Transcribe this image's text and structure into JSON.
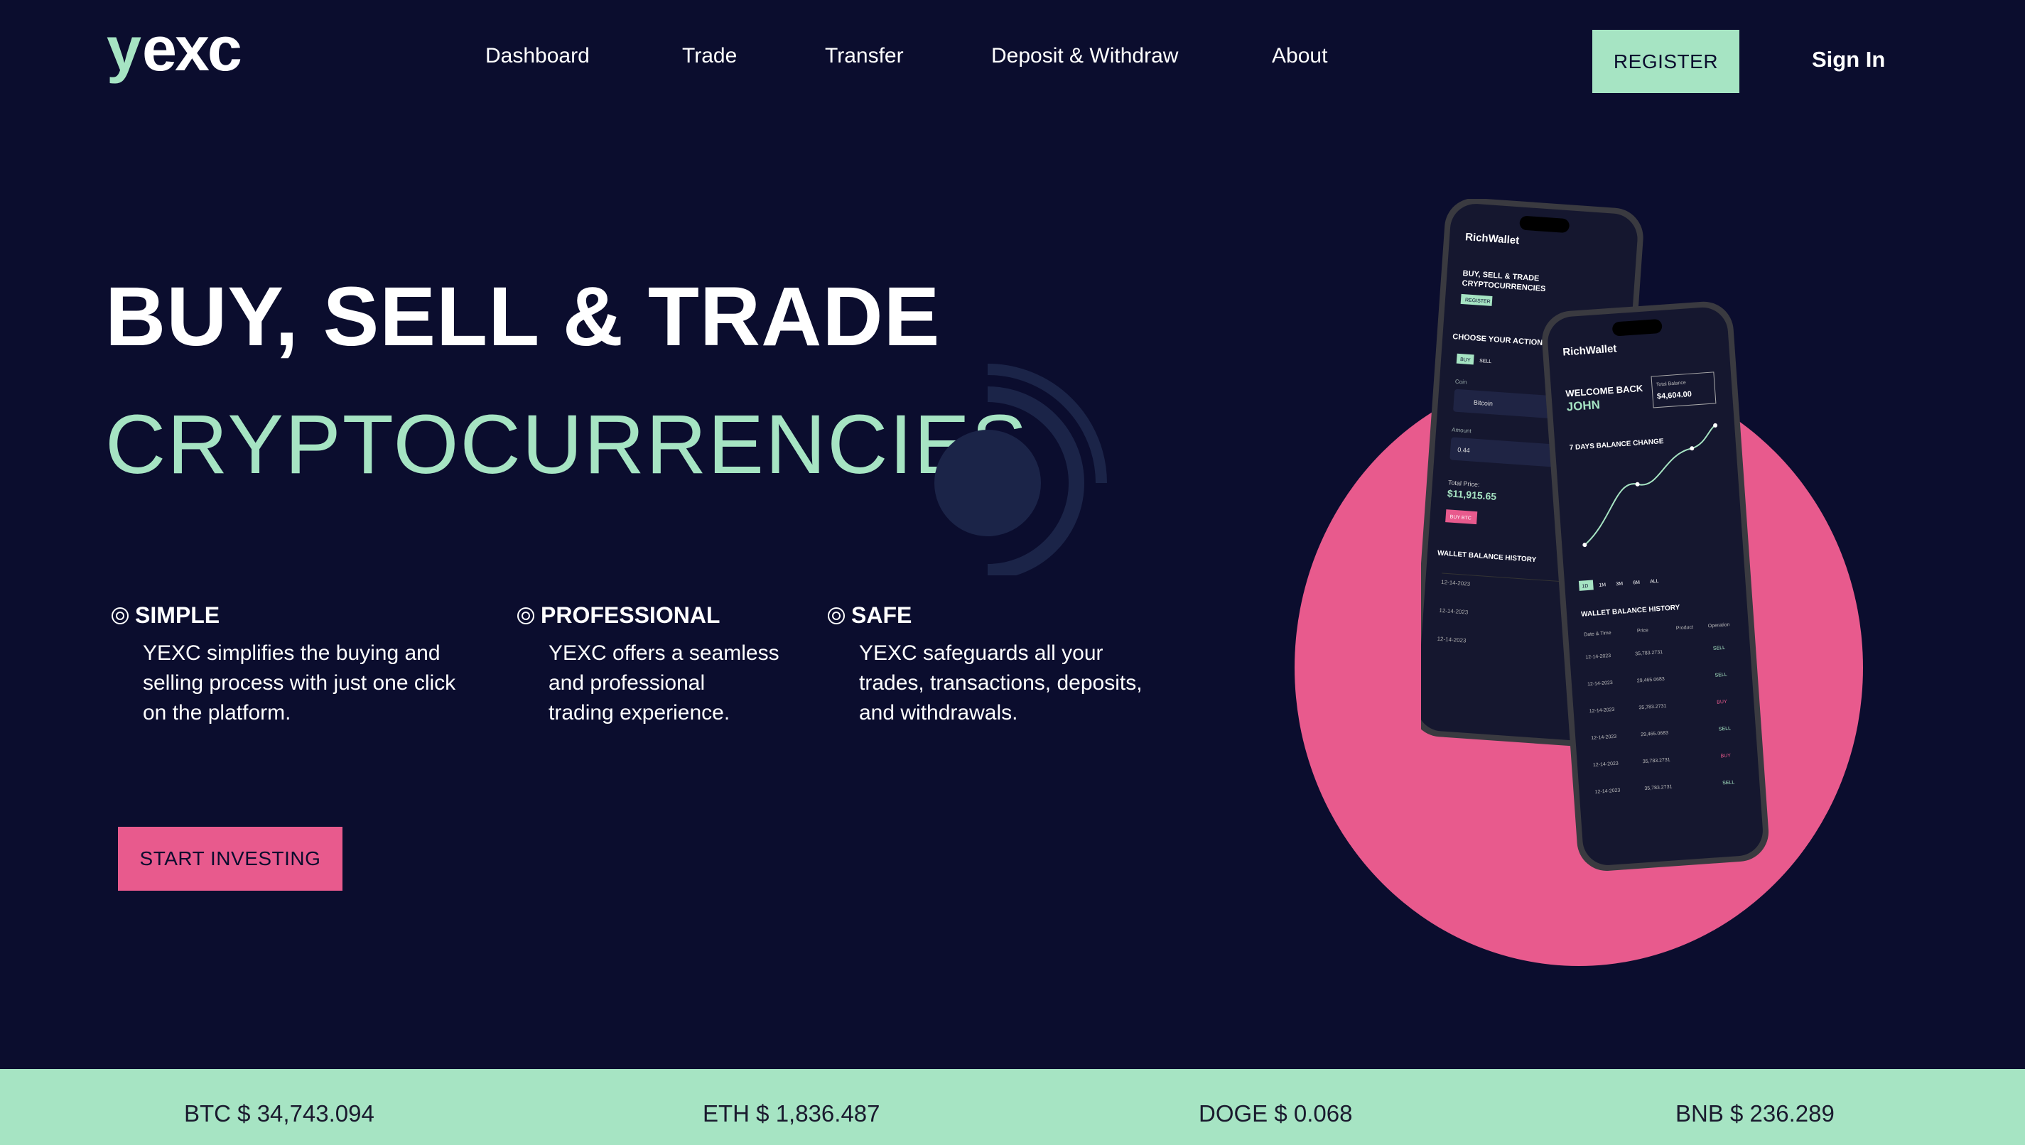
{
  "brand": {
    "logo_text": "yexc",
    "accent": "#a6e4c3",
    "pink": "#e85a8d",
    "background": "#0b0d2e"
  },
  "nav": {
    "items": [
      "Dashboard",
      "Trade",
      "Transfer",
      "Deposit & Withdraw",
      "About"
    ],
    "register_label": "REGISTER",
    "signin_label": "Sign In"
  },
  "hero": {
    "line1": "BUY, SELL & TRADE",
    "line2": "CRYPTOCURRENCIES",
    "features": [
      {
        "icon": "target-icon",
        "title": "SIMPLE",
        "lines": [
          "YEXC simplifies the buying and",
          "selling process with just one click",
          "on the platform."
        ]
      },
      {
        "icon": "target-icon",
        "title": "PROFESSIONAL",
        "lines": [
          "YEXC offers a seamless",
          "and professional",
          "trading experience."
        ]
      },
      {
        "icon": "target-icon",
        "title": "SAFE",
        "lines": [
          "YEXC safeguards all your",
          "trades, transactions, deposits,",
          "and withdrawals."
        ]
      }
    ],
    "cta_label": "START INVESTING"
  },
  "phone_back": {
    "app_name": "RichWallet",
    "heading": "BUY, SELL & TRADE CRYPTOCURRENCIES",
    "register": "REGISTER",
    "choose": "CHOOSE YOUR ACTION",
    "buy": "BUY",
    "sell": "SELL",
    "coin_label": "Coin",
    "coin": "Bitcoin",
    "amount_label": "Amount",
    "amount": "0.44",
    "total_label": "Total Price:",
    "total": "$11,915.65",
    "buy_btn": "BUY BTC",
    "history": "WALLET BALANCE HISTORY"
  },
  "phone_front": {
    "app_name": "RichWallet",
    "welcome": "WELCOME BACK",
    "name": "JOHN",
    "balance_label": "Total Balance",
    "balance": "$4,604.00",
    "chart_title": "7 DAYS BALANCE CHANGE",
    "ranges": [
      "1D",
      "1M",
      "3M",
      "6M",
      "ALL"
    ],
    "history": "WALLET BALANCE HISTORY",
    "columns": [
      "Date & Time",
      "Price",
      "Product",
      "Operation"
    ],
    "rows": [
      [
        "12-14-2023",
        "35,783.2731",
        "SELL"
      ],
      [
        "12-14-2023",
        "29,465.0683",
        "SELL"
      ],
      [
        "12-14-2023",
        "35,783.2731",
        "BUY"
      ],
      [
        "12-14-2023",
        "29,465.0683",
        "SELL"
      ],
      [
        "12-14-2023",
        "35,783.2731",
        "BUY"
      ],
      [
        "12-14-2023",
        "35,783.2731",
        "SELL"
      ]
    ]
  },
  "ticker": [
    {
      "label": "BTC $ 34,743.094"
    },
    {
      "label": "ETH $ 1,836.487"
    },
    {
      "label": "DOGE $ 0.068"
    },
    {
      "label": "BNB $ 236.289"
    }
  ]
}
